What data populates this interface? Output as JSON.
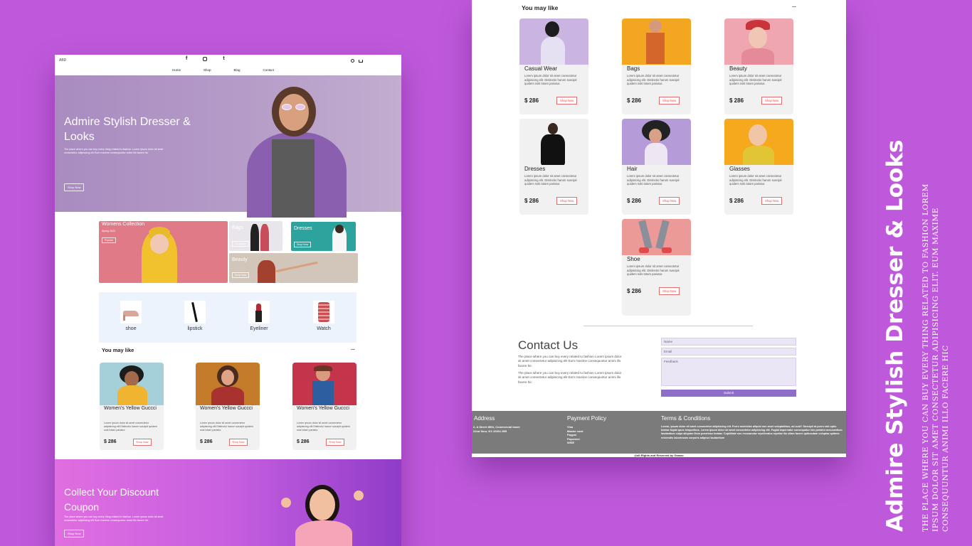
{
  "left": {
    "logo": "ABD",
    "social_icons": [
      "facebook-icon",
      "instagram-icon",
      "tumblr-icon"
    ],
    "nav": [
      "Home",
      "Shop",
      "Blog",
      "Contact"
    ],
    "hero": {
      "title": "Admire Stylish Dresser & Looks",
      "sub": "The place where you can buy every thing related to fashion. Lorem ipsum dolor sit amet consectetur adipisicing elit Eum maxime consequuntur animi illo facere hic",
      "button": "Shop Now"
    },
    "collections": {
      "womens": {
        "label": "Womens Collection",
        "sub": "Spring 2023",
        "button": "Popular"
      },
      "bags": {
        "label": "Bags",
        "button": "Shop Now"
      },
      "dresses": {
        "label": "Dresses",
        "button": "Shop Now"
      },
      "beauty": {
        "label": "Beauty",
        "button": "Shop Now"
      }
    },
    "categories": [
      "shoe",
      "lipstick",
      "Eyeliner",
      "Watch"
    ],
    "you_may_like": {
      "title": "You may like",
      "more": "..."
    },
    "cards": [
      {
        "name": "Women's Yellow Guccci",
        "desc": "Lorem ipsum dolor sit amet consectetur adipisicing elit Distinctio harum suscipit quidem sols totam pariatur.",
        "price": "$ 286",
        "button": "Shop Now"
      },
      {
        "name": "Women's Yellow Guccci",
        "desc": "Lorem ipsum dolor sit amet consectetur adipisicing elit Distinctio harum suscipit quidem sols totam pariatur.",
        "price": "$ 286",
        "button": "Shop Now"
      },
      {
        "name": "Women's Yellow Guccci",
        "desc": "Lorem ipsum dolor sit amet consectetur adipisicing elit Distinctio harum suscipit quidem sols totam pariatur.",
        "price": "$ 286",
        "button": "Shop Now"
      }
    ],
    "promo": {
      "title": "Collect Your Discount Coupon",
      "sub": "The place where you can buy every thing related to fashion. Lorem ipsum dolor sit amet consectetur adipisicing elit Eum maxime consequuntur animi illo facere hic",
      "button": "Shop Now"
    }
  },
  "right": {
    "you_may_like": {
      "title": "You may like",
      "more": "..."
    },
    "cards": [
      {
        "name": "Casual Wear",
        "desc": "Lorem ipsum dolor sit amet consectetur adipisicing elit. Distinctio harum suscipit quidem sols totam pariatur.",
        "price": "$ 286",
        "button": "Shop Now"
      },
      {
        "name": "Bags",
        "desc": "Lorem ipsum dolor sit amet consectetur adipisicing elit. Distinctio harum suscipit quidem sols totam pariatur.",
        "price": "$ 286",
        "button": "Shop Now"
      },
      {
        "name": "Beauty",
        "desc": "Lorem ipsum dolor sit amet consectetur adipisicing elit. Distinctio harum suscipit quidem sols totam pariatur.",
        "price": "$ 286",
        "button": "Shop Now"
      },
      {
        "name": "Dresses",
        "desc": "Lorem ipsum dolor sit amet consectetur adipisicing elit. Distinctio harum suscipit quidem sols totam pariatur.",
        "price": "$ 286",
        "button": "Shop Now"
      },
      {
        "name": "Hair",
        "desc": "Lorem ipsum dolor sit amet consectetur adipisicing elit. Distinctio harum suscipit quidem sols totam pariatur.",
        "price": "$ 286",
        "button": "Shop Now"
      },
      {
        "name": "Glasses",
        "desc": "Lorem ipsum dolor sit amet consectetur adipisicing elit. Distinctio harum suscipit quidem sols totam pariatur.",
        "price": "$ 286",
        "button": "Shop Now"
      },
      {
        "name": "Shoe",
        "desc": "Lorem ipsum dolor sit amet consectetur adipisicing elit. Distinctio harum suscipit quidem sols totam pariatur.",
        "price": "$ 286",
        "button": "Shop Now"
      }
    ],
    "contact": {
      "title": "Contact Us",
      "p1": "The place where you can buy every related to fashion Lorem ipsum dolor sit amet consectetur adipisicing elit Eum maxime consequuntur animi illo facere hic",
      "p2": "The place where you can buy every related to fashion Lorem ipsum dolor sit amet consectetur adipisicing elit Eum maxime consequuntur animi illo facere hic",
      "name_placeholder": "Name",
      "email_placeholder": "Email",
      "feedback_placeholder": "Feedback",
      "submit": "Submit"
    },
    "footer": {
      "address_title": "Address",
      "address_text": "2- A Street 89th, Commercial tower 22nd floor, NY-10001-595",
      "payment_title": "Payment Policy",
      "payment_items": [
        "Visa",
        "Master card",
        "Paypal",
        "Payoneer",
        "WISE"
      ],
      "terms_title": "Terms & Conditions",
      "terms_text": "Lorem, ipsum dolor sit amet consectetur adipisicing elit. Porro molestias aliquid non amet voluptatibus, ad sunt? Suscipit at porro sint optio beatae fugiat quos temporibus. Lorem ipsum dolor sit amet consectetur adipisicing elit. Fugiat aspernatur consequatur iste pariatur accusantium laudantium culpa aliquam illum possimus beatae. Cupiditate eos recusandae repellendus repellat illo ullam facere quibusdam voluptas quidem reiciendis laboriosam corporis adipisci laudantium",
      "copyright": "@all Rights and Reserved by Gamac"
    }
  },
  "side": {
    "title": "Admire Stylish Dresser & Looks",
    "sub": "THE PLACE WHERE YOU CAN BUY EVERY THING RELATED TO FASHION LOREM IPSUM DOLOR SIT AMET CONSECTETUR ADIPISICING ELIT. EUM MAXIME CONSEQUUNTUR ANIMI ILLO FACERE HIC"
  },
  "colors": {
    "background": "#bf59dc",
    "hero": "#a98bc0",
    "promo_start": "#e06ee0",
    "promo_end": "#8f3cc8",
    "footer": "#7b7b7b",
    "submit": "#8f6ec9",
    "shop_button": "#e05050"
  }
}
